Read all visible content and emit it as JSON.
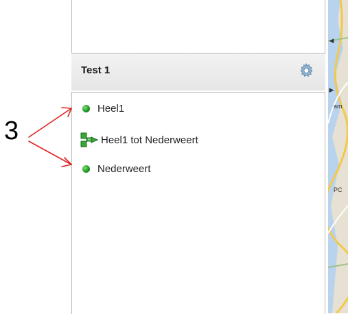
{
  "panel": {
    "title": "Test 1",
    "settings_icon": "gear-icon"
  },
  "list": {
    "items": [
      {
        "label": "Heel1",
        "icon": "green-dot-icon"
      },
      {
        "label": "Heel1 tot Nederweert",
        "icon": "route-icon"
      },
      {
        "label": "Nederweert",
        "icon": "green-dot-icon"
      }
    ]
  },
  "callout": {
    "number": "3",
    "color": "#e02020"
  },
  "map": {
    "labels": [
      "am",
      "PC"
    ]
  },
  "colors": {
    "dot_green": "#1f9a1f",
    "route_green": "#2e9e2e",
    "header_bg": "#ececec",
    "border": "#b8b8b8"
  }
}
